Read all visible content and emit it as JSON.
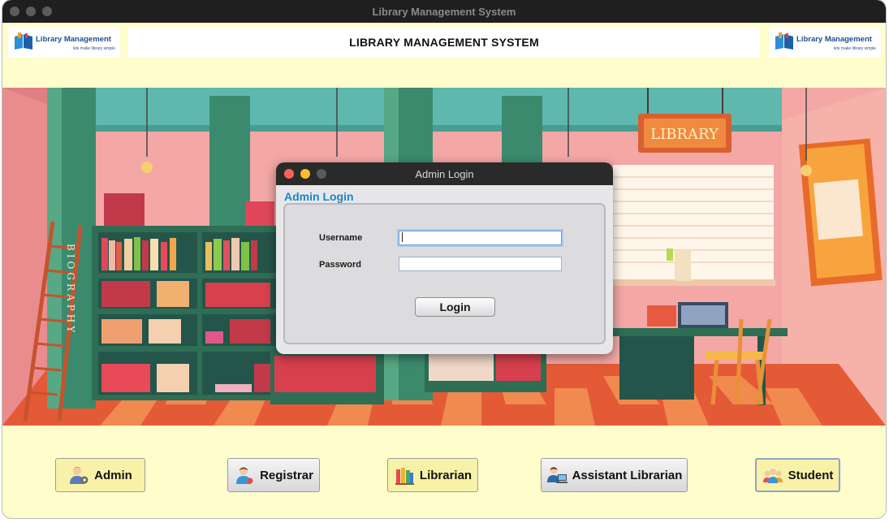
{
  "window": {
    "title": "Library Management System"
  },
  "logo": {
    "title": "Library Management",
    "subtitle": "lets make library simple"
  },
  "header": {
    "title": "LIBRARY MANAGEMENT SYSTEM"
  },
  "scene": {
    "library_sign": "LIBRARY",
    "bookcase_label": "BIOGRAPHY"
  },
  "dialog": {
    "window_title": "Admin Login",
    "heading": "Admin Login",
    "username_label": "Username",
    "username_value": "",
    "password_label": "Password",
    "password_value": "",
    "login_label": "Login"
  },
  "roles": {
    "admin": "Admin",
    "registrar": "Registrar",
    "librarian": "Librarian",
    "assistant": "Assistant Librarian",
    "student": "Student"
  },
  "icons": [
    "admin-user-icon",
    "registrar-user-icon",
    "books-icon",
    "assistant-computer-icon",
    "students-group-icon",
    "book-logo-icon"
  ],
  "colors": {
    "background": "#fefdcb",
    "accent": "#1a86c8",
    "titlebar": "#1f1f1f"
  }
}
